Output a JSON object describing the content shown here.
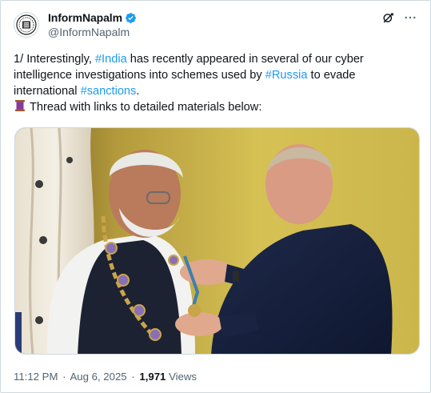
{
  "author": {
    "display_name": "InformNapalm",
    "handle": "@InformNapalm",
    "verified": true,
    "avatar_icon": "informnapalm-logo-icon"
  },
  "header_actions": {
    "grok_icon": "grok-icon",
    "more_icon": "more-horizontal-icon"
  },
  "tweet": {
    "line1_a": "1/ Interestingly, ",
    "hashtag_india": "#India",
    "line1_b": " has recently appeared in several of our cyber",
    "line2_a": "intelligence investigations into schemes used by ",
    "hashtag_russia": "#Russia",
    "line2_b": " to evade",
    "line3_a": "international ",
    "hashtag_sanctions": "#sanctions",
    "line3_b": ".",
    "line4_icon": "spool-of-thread-icon",
    "line4": "Thread with links to detailed materials below:"
  },
  "media": {
    "description_icon": "photo"
  },
  "meta": {
    "time": "11:12 PM",
    "date": "Aug 6, 2025",
    "separator": "·",
    "views_count": "1,971",
    "views_label": "Views"
  },
  "colors": {
    "text": "#0f1419",
    "secondary": "#536471",
    "accent": "#1d9bf0",
    "border": "#cfd9de"
  }
}
